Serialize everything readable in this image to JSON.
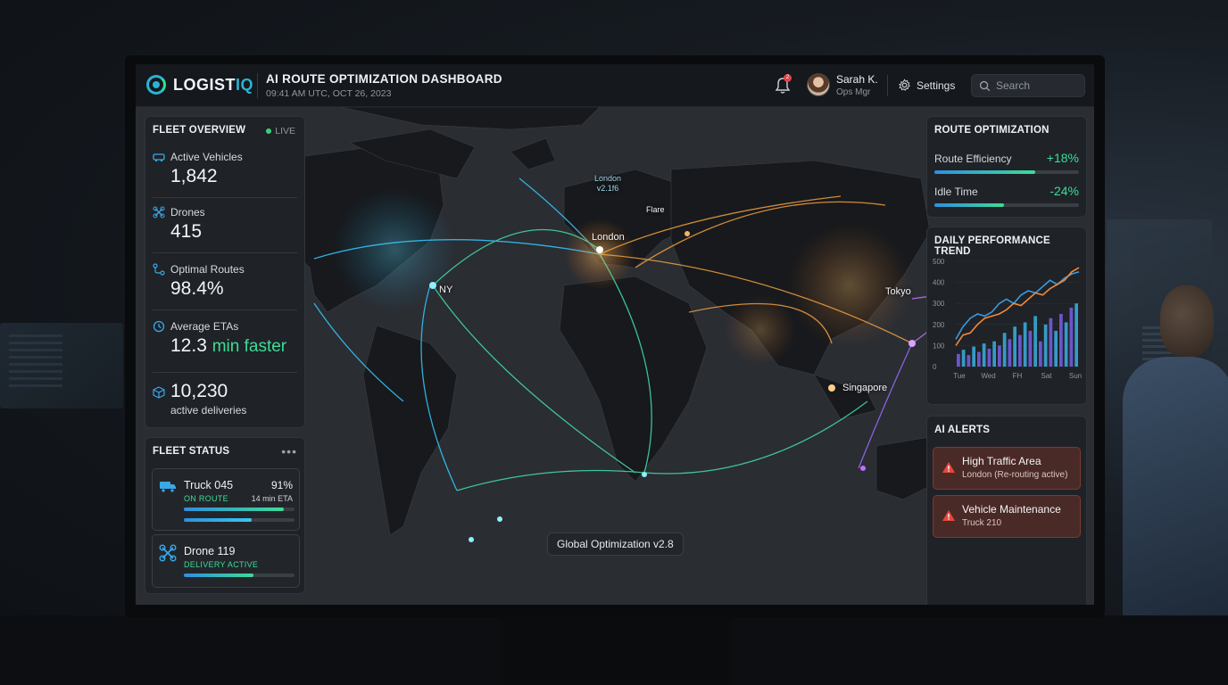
{
  "header": {
    "logo_prefix": "LOGIST",
    "logo_accent": "IQ",
    "title": "AI ROUTE OPTIMIZATION DASHBOARD",
    "timestamp": "09:41 AM UTC, OCT 26, 2023",
    "notification_count": "2",
    "user_name": "Sarah K.",
    "user_role": "Ops Mgr",
    "settings_label": "Settings",
    "search_placeholder": "Search"
  },
  "fleet_overview": {
    "title": "FLEET OVERVIEW",
    "live_label": "LIVE",
    "metrics": [
      {
        "label": "Active Vehicles",
        "value": "1,842",
        "icon": "truck-icon"
      },
      {
        "label": "Drones",
        "value": "415",
        "icon": "drone-icon"
      },
      {
        "label": "Optimal Routes",
        "value": "98.4%",
        "icon": "route-icon"
      },
      {
        "label": "Average ETAs",
        "value": "12.3",
        "value_suffix": "min faster",
        "icon": "clock-icon"
      },
      {
        "value": "10,230",
        "sub": "active deliveries",
        "icon": "package-icon"
      }
    ]
  },
  "fleet_status": {
    "title": "FLEET STATUS",
    "more": "•••",
    "cards": [
      {
        "name": "Truck 045",
        "state": "ON ROUTE",
        "percent": "91%",
        "eta": "14 min ETA",
        "progress": [
          0.9,
          0.61
        ]
      },
      {
        "name": "Drone 119",
        "state": "DELIVERY ACTIVE",
        "progress": [
          0.63
        ]
      }
    ]
  },
  "map": {
    "labels": {
      "london": "London",
      "london_tag": "London\nv2.1f6",
      "flare": "Flare",
      "ny": "NY",
      "tokyo": "Tokyo",
      "singapore": "Singapore"
    },
    "version_chip": "Global Optimization v2.8"
  },
  "route_optimization": {
    "title": "ROUTE OPTIMIZATION",
    "rows": [
      {
        "label": "Route Efficiency",
        "value": "+18%",
        "progress": 0.7
      },
      {
        "label": "Idle Time",
        "value": "-24%",
        "progress": 0.48
      }
    ]
  },
  "chart_data": {
    "type": "bar",
    "title": "DAILY PERFORMANCE TREND",
    "categories": [
      "Tue",
      "Wed",
      "FH",
      "Sat",
      "Sun"
    ],
    "yticks": [
      0,
      100,
      200,
      300,
      400,
      500
    ],
    "ylim": [
      0,
      500
    ],
    "bars": [
      60,
      80,
      55,
      95,
      70,
      110,
      85,
      120,
      100,
      160,
      130,
      190,
      150,
      210,
      170,
      240,
      120,
      200,
      230,
      170,
      250,
      210,
      280,
      300
    ],
    "series": [
      {
        "color": "#3a9be0",
        "values": [
          130,
          190,
          230,
          250,
          240,
          260,
          300,
          320,
          300,
          340,
          360,
          350,
          380,
          410,
          390,
          420,
          440,
          450
        ]
      },
      {
        "color": "#f08a3a",
        "values": [
          100,
          150,
          160,
          200,
          230,
          240,
          250,
          270,
          300,
          290,
          320,
          350,
          340,
          370,
          390,
          410,
          450,
          470
        ]
      }
    ]
  },
  "ai_alerts": {
    "title": "AI ALERTS",
    "items": [
      {
        "title": "High Traffic Area",
        "sub": "London (Re-routing active)"
      },
      {
        "title": "Vehicle Maintenance",
        "sub": "Truck 210"
      }
    ]
  }
}
